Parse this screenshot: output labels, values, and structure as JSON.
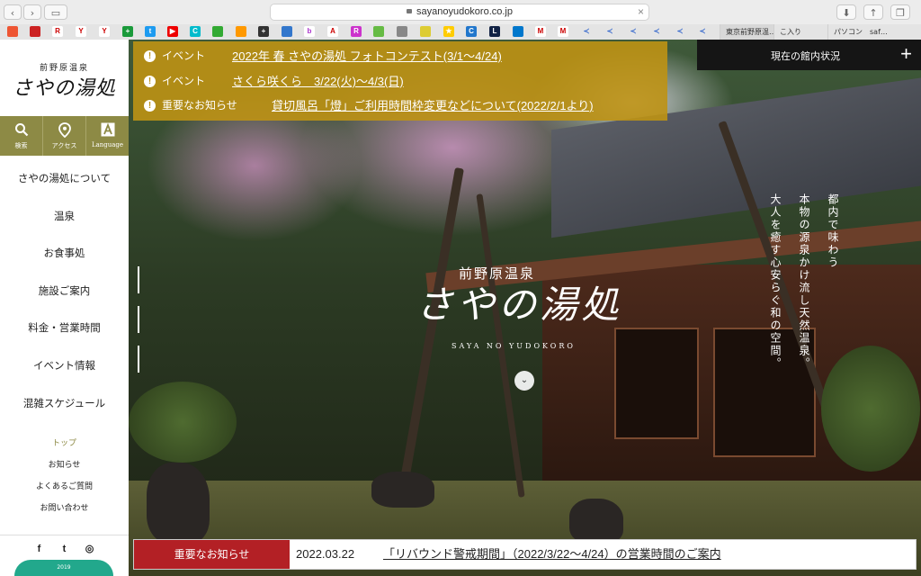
{
  "browser": {
    "url": "sayanoyudokoro.co.jp",
    "tabs": [
      "東京前野原温…",
      "こ入り",
      "パソコン　saf…"
    ]
  },
  "sidebar": {
    "logo_sub": "前野原温泉",
    "logo_main": "さやの湯処",
    "tools": [
      {
        "icon": "search-icon",
        "label": "検索"
      },
      {
        "icon": "location-pin-icon",
        "label": "アクセス"
      },
      {
        "icon": "language-icon",
        "label": "Language"
      }
    ],
    "nav": [
      "さやの湯処について",
      "温泉",
      "お食事処",
      "施設ご案内",
      "料金・営業時間",
      "イベント情報",
      "混雑スケジュール"
    ],
    "sub": [
      "トップ",
      "お知らせ",
      "よくあるご質問",
      "お問い合わせ"
    ],
    "social": [
      {
        "icon": "facebook-icon",
        "glyph": "f"
      },
      {
        "icon": "twitter-icon",
        "glyph": "t"
      },
      {
        "icon": "instagram-icon",
        "glyph": "◎"
      }
    ],
    "badge": "2019"
  },
  "notices": [
    {
      "category": "イベント",
      "title": "2022年 春 さやの湯処 フォトコンテスト(3/1〜4/24)"
    },
    {
      "category": "イベント",
      "title": "さくら咲くら　3/22(火)〜4/3(日)"
    },
    {
      "category": "重要なお知らせ",
      "title": "貸切風呂「燈」ご利用時間枠変更などについて(2022/2/1より)"
    }
  ],
  "status": {
    "label": "現在の館内状況",
    "expand": "+"
  },
  "hero": {
    "logo_sub": "前野原温泉",
    "logo_main": "さやの湯処",
    "logo_romaji": "SAYA NO YUDOKORO",
    "tagline": [
      "都内で味わう",
      "本物の源泉かけ流し天然温泉。",
      "大人を癒す心安らぐ和の空間。"
    ],
    "scroll": "⌄"
  },
  "news": {
    "category": "重要なお知らせ",
    "date": "2022.03.22",
    "title": "「リバウンド警戒期間」（2022/3/22〜4/24）の営業時間のご案内"
  },
  "colors": {
    "accent_olive": "#8d8a45",
    "notice_gold": "#be9214",
    "news_red": "#b32025"
  }
}
